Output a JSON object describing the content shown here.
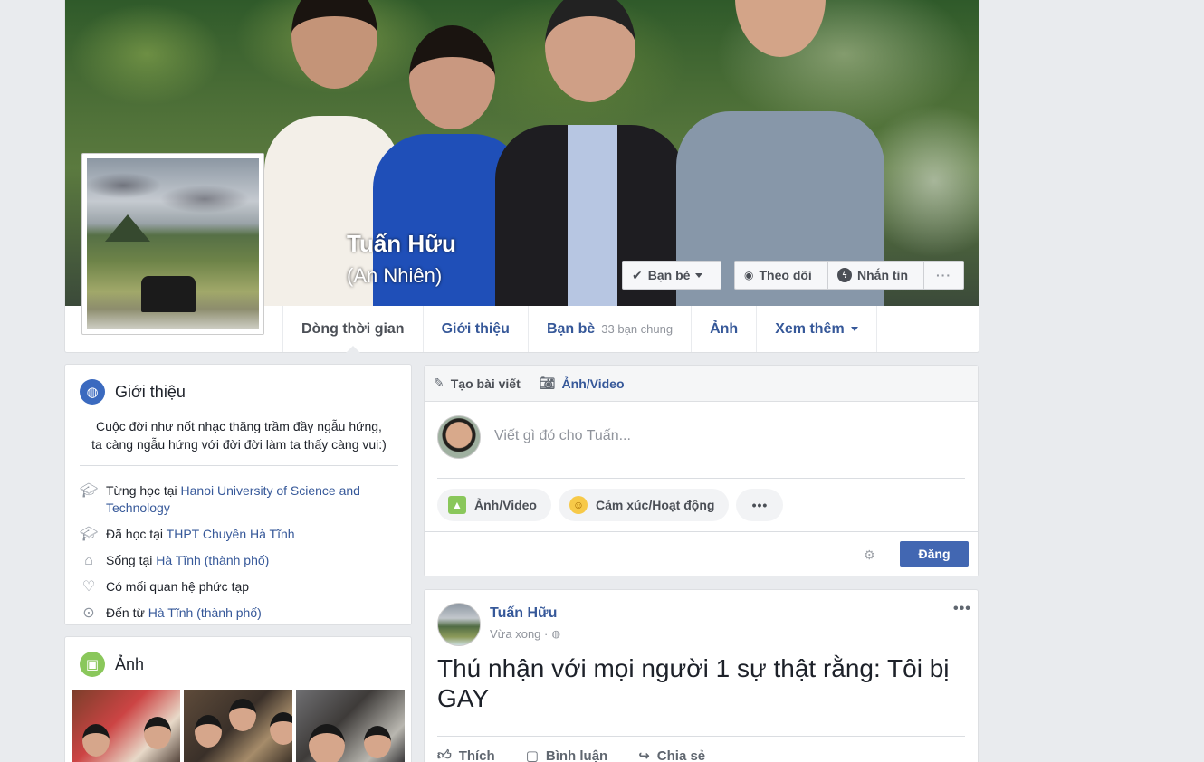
{
  "profile": {
    "name": "Tuấn Hữu",
    "alternate_name": "(An Nhiên)"
  },
  "cover_actions": {
    "friends_label": "Bạn bè",
    "follow_label": "Theo dõi",
    "message_label": "Nhắn tin",
    "more_label": "···"
  },
  "tabs": [
    {
      "label": "Dòng thời gian",
      "sub": ""
    },
    {
      "label": "Giới thiệu",
      "sub": ""
    },
    {
      "label": "Bạn bè",
      "sub": "33 bạn chung"
    },
    {
      "label": "Ảnh",
      "sub": ""
    },
    {
      "label": "Xem thêm",
      "sub": ""
    }
  ],
  "intro": {
    "title": "Giới thiệu",
    "bio_line1": "Cuộc đời như nốt nhạc thăng trầm đầy ngẫu hứng,",
    "bio_line2": "ta càng ngẫu hứng với đời đời làm ta thấy càng vui:)",
    "items": [
      {
        "icon": "graduation-cap-icon",
        "prefix": "Từng học tại ",
        "link": "Hanoi University of Science and Technology"
      },
      {
        "icon": "graduation-cap-icon",
        "prefix": "Đã học tại ",
        "link": "THPT Chuyên Hà Tĩnh"
      },
      {
        "icon": "home-icon",
        "prefix": "Sống tại ",
        "link": "Hà Tĩnh (thành phố)"
      },
      {
        "icon": "heart-icon",
        "prefix": "Có mối quan hệ phức tạp",
        "link": ""
      },
      {
        "icon": "location-pin-icon",
        "prefix": "Đến từ ",
        "link": "Hà Tĩnh (thành phố)"
      }
    ]
  },
  "photos": {
    "title": "Ảnh"
  },
  "composer": {
    "create_post_label": "Tạo bài viết",
    "photo_video_tab_label": "Ảnh/Video",
    "placeholder": "Viết gì đó cho Tuấn...",
    "photo_video_label": "Ảnh/Video",
    "feeling_label": "Cảm xúc/Hoạt động",
    "more_label": "•••",
    "post_button_label": "Đăng"
  },
  "post": {
    "author": "Tuấn Hữu",
    "time": "Vừa xong ·",
    "text": "Thú nhận với mọi người 1 sự thật rằng: Tôi bị GAY",
    "menu": "•••",
    "like_label": "Thích",
    "comment_label": "Bình luận",
    "share_label": "Chia sẻ"
  },
  "colors": {
    "link": "#365899",
    "primary_button": "#4267b2",
    "page_background": "#e9ebee"
  }
}
